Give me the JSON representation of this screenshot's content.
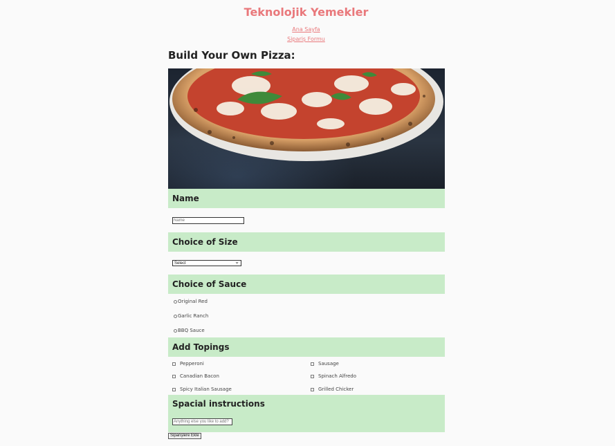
{
  "site": {
    "title": "Teknolojik Yemekler"
  },
  "nav": {
    "items": [
      "Ana Sayfa",
      "Sipariş Formu"
    ]
  },
  "page": {
    "heading": "Build Your Own Pizza:"
  },
  "image": {
    "alt": "pizza-photo"
  },
  "sections": {
    "name": "Name",
    "size": "Choice of Size",
    "sauce": "Choice of Sauce",
    "toppings": "Add Topings",
    "instructions": "Spacial instructions"
  },
  "form": {
    "name_placeholder": "Name",
    "size_value": "Select",
    "sauces": [
      "Original Red",
      "Garlic Ranch",
      "BBQ Sauce"
    ],
    "toppings_left": [
      "Pepperoni",
      "Canadian Bacon",
      "Spicy Italian Sausage"
    ],
    "toppings_right": [
      "Sausage",
      "Spinach Alfredo",
      "Grilled Chicker"
    ],
    "instructions_placeholder": "Anything else you like to add?",
    "submit_label": "Siparişlere Ekle"
  },
  "colors": {
    "accent": "#e9787b",
    "section_bg": "#c8ebc8",
    "page_bg": "#fafafa"
  }
}
